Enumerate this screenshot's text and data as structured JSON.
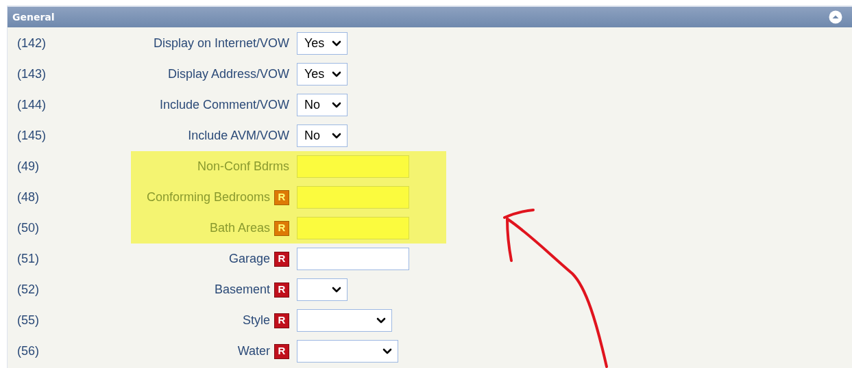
{
  "panel": {
    "title": "General"
  },
  "rows": [
    {
      "number": "(142)",
      "label": "Display on Internet/VOW",
      "required": false,
      "highlighted": false,
      "kind": "short-select",
      "value": "Yes"
    },
    {
      "number": "(143)",
      "label": "Display Address/VOW",
      "required": false,
      "highlighted": false,
      "kind": "short-select",
      "value": "Yes"
    },
    {
      "number": "(144)",
      "label": "Include Comment/VOW",
      "required": false,
      "highlighted": false,
      "kind": "short-select",
      "value": "No"
    },
    {
      "number": "(145)",
      "label": "Include AVM/VOW",
      "required": false,
      "highlighted": false,
      "kind": "short-select",
      "value": "No"
    },
    {
      "number": "(49)",
      "label": "Non-Conf Bdrms",
      "required": false,
      "highlighted": true,
      "kind": "text"
    },
    {
      "number": "(48)",
      "label": "Conforming Bedrooms",
      "required": true,
      "badge": "R",
      "highlighted": true,
      "kind": "text"
    },
    {
      "number": "(50)",
      "label": "Bath Areas",
      "required": true,
      "badge": "R",
      "highlighted": true,
      "kind": "text"
    },
    {
      "number": "(51)",
      "label": "Garage",
      "required": true,
      "badge": "R",
      "highlighted": false,
      "kind": "text"
    },
    {
      "number": "(52)",
      "label": "Basement",
      "required": true,
      "badge": "R",
      "highlighted": false,
      "kind": "short-select"
    },
    {
      "number": "(55)",
      "label": "Style",
      "required": true,
      "badge": "R",
      "highlighted": false,
      "kind": "medium-select"
    },
    {
      "number": "(56)",
      "label": "Water",
      "required": true,
      "badge": "R",
      "highlighted": false,
      "kind": "wide-select"
    }
  ]
}
